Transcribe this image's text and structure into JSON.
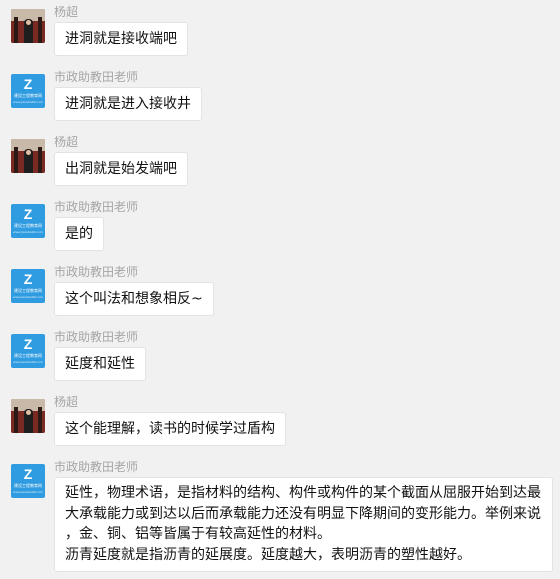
{
  "users": {
    "yang": "杨超",
    "teacher": "市政助教田老师"
  },
  "teacher_avatar": {
    "mark": "Z",
    "brand": "建设工程教育网",
    "sub": "www.jianshe99.com"
  },
  "messages": [
    {
      "sender": "杨超",
      "avatar": "photo",
      "text": "进洞就是接收端吧"
    },
    {
      "sender": "市政助教田老师",
      "avatar": "logo",
      "text": "进洞就是进入接收井"
    },
    {
      "sender": "杨超",
      "avatar": "photo",
      "text": "出洞就是始发端吧"
    },
    {
      "sender": "市政助教田老师",
      "avatar": "logo",
      "text": "是的"
    },
    {
      "sender": "市政助教田老师",
      "avatar": "logo",
      "text": "这个叫法和想象相反~"
    },
    {
      "sender": "市政助教田老师",
      "avatar": "logo",
      "text": "延度和延性"
    },
    {
      "sender": "杨超",
      "avatar": "photo",
      "text": "这个能理解，读书的时候学过盾构"
    },
    {
      "sender": "市政助教田老师",
      "avatar": "logo",
      "lines": [
        "延性，物理术语，是指材料的结构、构件或构件的某个截面从屈服开始到达最",
        "大承载能力或到达以后而承载能力还没有明显下降期间的变形能力。举例来说",
        "，金、铜、铝等皆属于有较高延性的材料。",
        "沥青延度就是指沥青的延展度。延度越大，表明沥青的塑性越好。"
      ]
    }
  ]
}
